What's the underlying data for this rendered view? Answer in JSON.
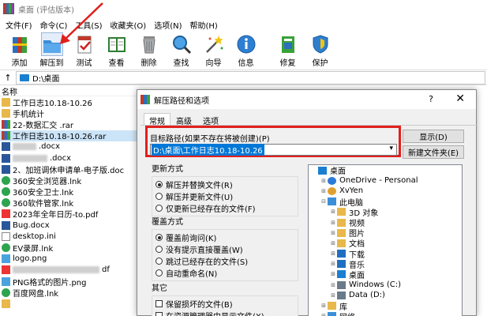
{
  "window": {
    "title": "桌面 (评估版本)"
  },
  "menu": [
    "文件(F)",
    "命令(C)",
    "工具(S)",
    "收藏夹(O)",
    "选项(N)",
    "帮助(H)"
  ],
  "toolbar": [
    {
      "label": "添加",
      "icon": "add-icon"
    },
    {
      "label": "解压到",
      "icon": "extract-to-icon"
    },
    {
      "label": "测试",
      "icon": "test-icon"
    },
    {
      "label": "查看",
      "icon": "view-icon"
    },
    {
      "label": "删除",
      "icon": "delete-icon"
    },
    {
      "label": "查找",
      "icon": "find-icon"
    },
    {
      "label": "向导",
      "icon": "wizard-icon"
    },
    {
      "label": "信息",
      "icon": "info-icon"
    },
    {
      "label": "修复",
      "icon": "repair-icon"
    },
    {
      "label": "保护",
      "icon": "protect-icon"
    }
  ],
  "address": {
    "path": "D:\\桌面"
  },
  "filelist": {
    "header": "名称",
    "files": [
      {
        "name": "工作日志10.18-10.26",
        "type": "folder"
      },
      {
        "name": "手机统计",
        "type": "folder"
      },
      {
        "name": "22-数据汇交 .rar",
        "type": "rar"
      },
      {
        "name": "工作日志10.18-10.26.rar",
        "type": "rar"
      },
      {
        "name": ".docx",
        "type": "docx"
      },
      {
        "name": ".docx",
        "type": "docx"
      },
      {
        "name": "2、加班调休申请单-电子版.doc",
        "type": "docx"
      },
      {
        "name": "360安全浏览器.lnk",
        "type": "lnk"
      },
      {
        "name": "360安全卫士.lnk",
        "type": "lnk"
      },
      {
        "name": "360软件管家.lnk",
        "type": "lnk"
      },
      {
        "name": "2023年全年日历-to.pdf",
        "type": "pdf"
      },
      {
        "name": "Bug.docx",
        "type": "docx"
      },
      {
        "name": "desktop.ini",
        "type": "ini"
      },
      {
        "name": "EV录屏.lnk",
        "type": "lnk"
      },
      {
        "name": "logo.png",
        "type": "png"
      },
      {
        "name": "df",
        "type": "pdf"
      },
      {
        "name": "PNG格式的图片.png",
        "type": "png"
      },
      {
        "name": "百度网盘.lnk",
        "type": "lnk"
      },
      {
        "name": "",
        "type": "folder"
      }
    ]
  },
  "dialog": {
    "title": "解压路径和选项",
    "help": "?",
    "close": "✕",
    "tabs": [
      "常规",
      "高级",
      "选项"
    ],
    "dest_label": "目标路径(如果不存在将被创建)(P)",
    "dest_value": "D:\\桌面\\工作日志10.18-10.26",
    "show_button": "显示(D)",
    "new_folder_button": "新建文件夹(E)",
    "update_mode": {
      "title": "更新方式",
      "options": [
        "解压并替换文件(R)",
        "解压并更新文件(U)",
        "仅更新已经存在的文件(F)"
      ],
      "selected": 0
    },
    "overwrite_mode": {
      "title": "覆盖方式",
      "options": [
        "覆盖前询问(K)",
        "没有提示直接覆盖(W)",
        "跳过已经存在的文件(S)",
        "自动重命名(N)"
      ],
      "selected": 0
    },
    "misc": {
      "title": "其它",
      "options": [
        "保留损坏的文件(B)",
        "在资源管理器中显示文件(X)"
      ]
    },
    "tree": [
      {
        "label": "桌面",
        "level": 0,
        "exp": "",
        "icon": "desktop"
      },
      {
        "label": "OneDrive - Personal",
        "level": 1,
        "exp": "⊞",
        "icon": "cloud"
      },
      {
        "label": "XvYen",
        "level": 1,
        "exp": "⊞",
        "icon": "user"
      },
      {
        "label": "此电脑",
        "level": 1,
        "exp": "⊟",
        "icon": "pc"
      },
      {
        "label": "3D 对象",
        "level": 2,
        "exp": "⊞",
        "icon": "folder"
      },
      {
        "label": "视频",
        "level": 2,
        "exp": "⊞",
        "icon": "folder"
      },
      {
        "label": "图片",
        "level": 2,
        "exp": "⊞",
        "icon": "folder"
      },
      {
        "label": "文档",
        "level": 2,
        "exp": "⊞",
        "icon": "folder"
      },
      {
        "label": "下载",
        "level": 2,
        "exp": "⊞",
        "icon": "download"
      },
      {
        "label": "音乐",
        "level": 2,
        "exp": "⊞",
        "icon": "music"
      },
      {
        "label": "桌面",
        "level": 2,
        "exp": "⊞",
        "icon": "desktop"
      },
      {
        "label": "Windows (C:)",
        "level": 2,
        "exp": "⊞",
        "icon": "drive"
      },
      {
        "label": "Data (D:)",
        "level": 2,
        "exp": "⊞",
        "icon": "drive"
      },
      {
        "label": "库",
        "level": 1,
        "exp": "⊞",
        "icon": "folder"
      },
      {
        "label": "网络",
        "level": 1,
        "exp": "⊞",
        "icon": "network"
      }
    ]
  }
}
